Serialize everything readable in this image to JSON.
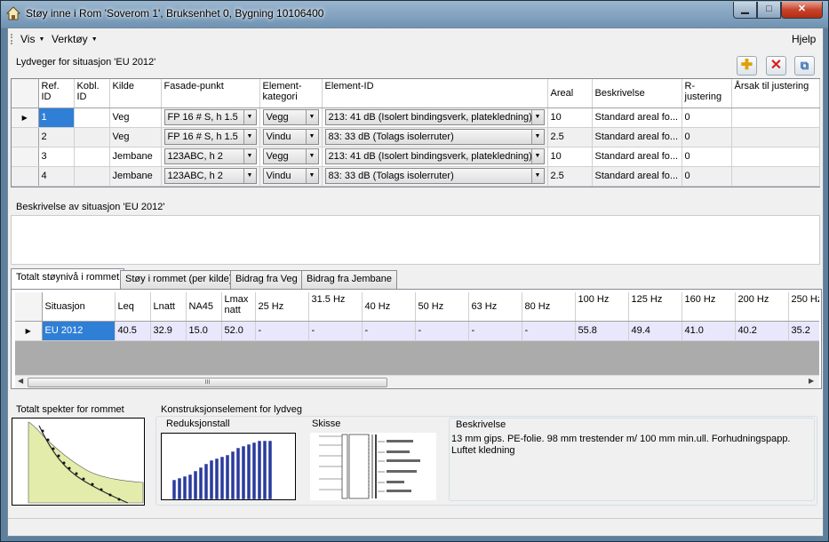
{
  "window": {
    "title": "Støy inne i Rom 'Soverom 1', Bruksenhet 0, Bygning 10106400",
    "min_glyph": "▁",
    "max_glyph": "□",
    "close_glyph": "✕"
  },
  "menu": {
    "vis": "Vis",
    "verktoy": "Verktøy",
    "hjelp": "Hjelp"
  },
  "lydveger": {
    "heading": "Lydveger for situasjon 'EU 2012'",
    "columns": {
      "ref_id": "Ref. ID",
      "kobl_id": "Kobl. ID",
      "kilde": "Kilde",
      "fasadepunkt": "Fasade-punkt",
      "elementkategori": "Element-kategori",
      "element_id": "Element-ID",
      "areal": "Areal",
      "beskrivelse": "Beskrivelse",
      "r_justering": "R-justering",
      "arsak": "Årsak til justering"
    },
    "rows": [
      {
        "ref_id": "1",
        "kobl_id": "",
        "kilde": "Veg",
        "fasadepunkt": "FP 16 # S, h 1.5",
        "kategori": "Vegg",
        "element": "213: 41 dB (Isolert bindingsverk, platekledning)",
        "areal": "10",
        "beskrivelse": "Standard areal fo...",
        "r_justering": "0",
        "arsak": ""
      },
      {
        "ref_id": "2",
        "kobl_id": "",
        "kilde": "Veg",
        "fasadepunkt": "FP 16 # S, h 1.5",
        "kategori": "Vindu",
        "element": "83: 33 dB (Tolags isolerruter)",
        "areal": "2.5",
        "beskrivelse": "Standard areal fo...",
        "r_justering": "0",
        "arsak": ""
      },
      {
        "ref_id": "3",
        "kobl_id": "",
        "kilde": "Jembane",
        "fasadepunkt": "123ABC, h 2",
        "kategori": "Vegg",
        "element": "213: 41 dB (Isolert bindingsverk, platekledning)",
        "areal": "10",
        "beskrivelse": "Standard areal fo...",
        "r_justering": "0",
        "arsak": ""
      },
      {
        "ref_id": "4",
        "kobl_id": "",
        "kilde": "Jembane",
        "fasadepunkt": "123ABC, h 2",
        "kategori": "Vindu",
        "element": "83: 33 dB (Tolags isolerruter)",
        "areal": "2.5",
        "beskrivelse": "Standard areal fo...",
        "r_justering": "0",
        "arsak": ""
      }
    ]
  },
  "beskrivelse_heading": "Beskrivelse av situasjon 'EU 2012'",
  "tabs": [
    "Totalt støynivå i rommet",
    "Støy i rommet (per kilde)",
    "Bidrag fra Veg",
    "Bidrag fra Jembane"
  ],
  "noise": {
    "columns": [
      "Situasjon",
      "Leq",
      "Lnatt",
      "NA45",
      "Lmax natt",
      "25 Hz",
      "31.5 Hz",
      "40 Hz",
      "50 Hz",
      "63 Hz",
      "80 Hz",
      "100 Hz",
      "125 Hz",
      "160 Hz",
      "200 Hz",
      "250 Hz"
    ],
    "row": [
      "EU 2012",
      "40.5",
      "32.9",
      "15.0",
      "52.0",
      "-",
      "-",
      "-",
      "-",
      "-",
      "-",
      "55.8",
      "49.4",
      "41.0",
      "40.2",
      "35.2"
    ],
    "scroll_grip": "III"
  },
  "bottom": {
    "spekter_title": "Totalt spekter for rommet",
    "konstruksjon_title": "Konstruksjonselement for lydveg",
    "reduksjon_title": "Reduksjonstall",
    "skisse_title": "Skisse",
    "beskrivelse_title": "Beskrivelse",
    "beskrivelse_text": "13 mm gips. PE-folie. 98 mm trestender m/ 100 mm min.ull. Forhudningspapp. Luftet kledning"
  },
  "colors": {
    "selection": "#2f7fd6",
    "row_highlight": "#e9e7fb",
    "bar_fill": "#2b3a9c",
    "spectrum_fill": "#e3ecaa"
  }
}
